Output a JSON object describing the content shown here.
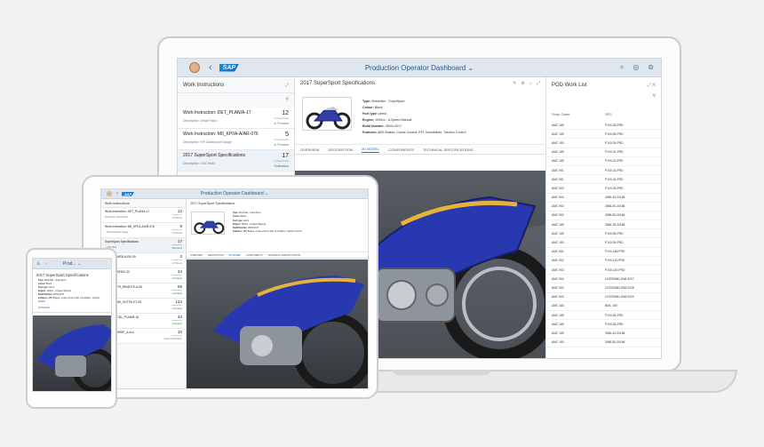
{
  "app": {
    "title": "Production Operator Dashboard",
    "title_short": "Prod...",
    "logo": "SAP",
    "back_icon": "chevron-left-icon",
    "dropdown_icon": "chevron-down-icon",
    "right_icons": [
      "search-icon",
      "settings-icon",
      "help-icon"
    ]
  },
  "work_instructions": {
    "title": "Work Instructions",
    "items": [
      {
        "name": "Work Instruction: DET_PLAN/A-17",
        "desc": "Description: Detail Plans",
        "count": "12",
        "unit": "components",
        "status": "In Process"
      },
      {
        "name": "Work Instruction: MII_KPI/A-A/AR-076",
        "desc": "Description: KPI Dashboard Gauge",
        "count": "5",
        "unit": "components",
        "status": "In Process"
      },
      {
        "name": "2017 SuperSport Specifications",
        "desc": "Description: CNC Mold",
        "count": "17",
        "unit": "components",
        "status": "Estimation"
      }
    ],
    "tablet_items": [
      {
        "name": "Work Instruction: DET_PLAN/A-17",
        "desc": "Description: Detail Plans",
        "count": "12",
        "unit": "components",
        "status": "In Process"
      },
      {
        "name": "Work Instruction: MII_KPI/A-A/AR-076",
        "desc": "...KPI Dashboard Gauge",
        "count": "5",
        "unit": "components",
        "status": "In Process"
      },
      {
        "name": "SuperSport Specifications",
        "desc": "...CNC Mold",
        "count": "17",
        "unit": "components",
        "status": "Estimation"
      },
      {
        "name": "...uction: WEB-A-RA-09",
        "desc": "...Web Ve",
        "count": "3",
        "unit": "components",
        "status": "In Process"
      },
      {
        "name": "...uction: BEKIC-02",
        "desc": "...Bekic",
        "count": "24",
        "unit": "components",
        "status": "Completed"
      },
      {
        "name": "...uction: PH_REMOTE-A-05",
        "desc": "...Remote Ve",
        "count": "55",
        "unit": "components",
        "status": "Completed"
      },
      {
        "name": "...uction: MII_OUTPA-VT-09",
        "desc": "...Sensitiv",
        "count": "124",
        "unit": "components",
        "status": "Completed"
      },
      {
        "name": "...uction: CBL_PLAN/B-18",
        "desc": "...Cable Plan",
        "count": "42",
        "unit": "components",
        "status": "Completed"
      },
      {
        "name": "...uction: BRSP_A-nt-n",
        "desc": "...Bax Hat",
        "count": "10",
        "unit": "components",
        "status": "Under Confirmation"
      }
    ]
  },
  "spec": {
    "title": "2017 SuperSport Specifications",
    "props": [
      {
        "label": "Type:",
        "value": "Motorbike - SuperSport"
      },
      {
        "label": "Colour:",
        "value": "Black"
      },
      {
        "label": "Fuel type:",
        "value": "petrol"
      },
      {
        "label": "Engine:",
        "value": "1000cc - 6-Speed Manual"
      },
      {
        "label": "Build Number:",
        "value": "26/04-2017"
      },
      {
        "label": "Features:",
        "value": "ABS Brakes, Cruise Control, EFI, Immobilizer, Traction Control"
      }
    ],
    "tabs": [
      "OVERVIEW",
      "DESCRIPTION",
      "3D MODEL",
      "COMPONENTS",
      "TECHNICAL SPECIFICATIONS"
    ],
    "active_tab": "3D MODEL"
  },
  "pod": {
    "title": "POD Work List",
    "col_shop_order": "Shop Order",
    "col_sfc": "SFC",
    "rows": [
      [
        "AMC 180",
        "P100-36-PRD"
      ],
      [
        "AMC 180",
        "P100-06-PRD"
      ],
      [
        "AMC 180",
        "P100-35-PRD"
      ],
      [
        "AMC 180",
        "P100-31-PRD"
      ],
      [
        "AMC 180",
        "P100-32-PRD"
      ],
      [
        "AMC 901",
        "P100-33-PRD"
      ],
      [
        "AMC 901",
        "P100-34-PRD"
      ],
      [
        "AMC 903",
        "P100-35-PRD"
      ],
      [
        "AMC 904",
        "3066-43-20166"
      ],
      [
        "AMC 902",
        "3066-30-20166"
      ],
      [
        "AMC 902",
        "3066-65-20166"
      ],
      [
        "AMC 180",
        "3066-78-20166"
      ],
      [
        "AMC 180",
        "P100-96-PRD"
      ],
      [
        "AMC 180",
        "P100-99-PRD"
      ],
      [
        "AMC 901",
        "P100-188-PRD"
      ],
      [
        "AMC 902",
        "P100-119-PRD"
      ],
      [
        "AMC 903",
        "P100-120-PRD"
      ],
      [
        "AMC 904",
        "CAT0008KLGWL0027"
      ],
      [
        "AMC 902",
        "CAT0008KLGWL0028"
      ],
      [
        "AMC 903",
        "CAT0008KLGWL0029"
      ],
      [
        "AMC 180",
        "BMC 100"
      ],
      [
        "AMC 180",
        "P100-54-PRD"
      ],
      [
        "AMC 180",
        "P100-55-PRD"
      ],
      [
        "AMC 180",
        "3066-44-20166"
      ],
      [
        "AMC 180",
        "3066-55-20166"
      ]
    ]
  },
  "colors": {
    "shell_bg": "#dfe6ee",
    "accent": "#1a6fc4",
    "status_green": "#2b8a3e"
  }
}
